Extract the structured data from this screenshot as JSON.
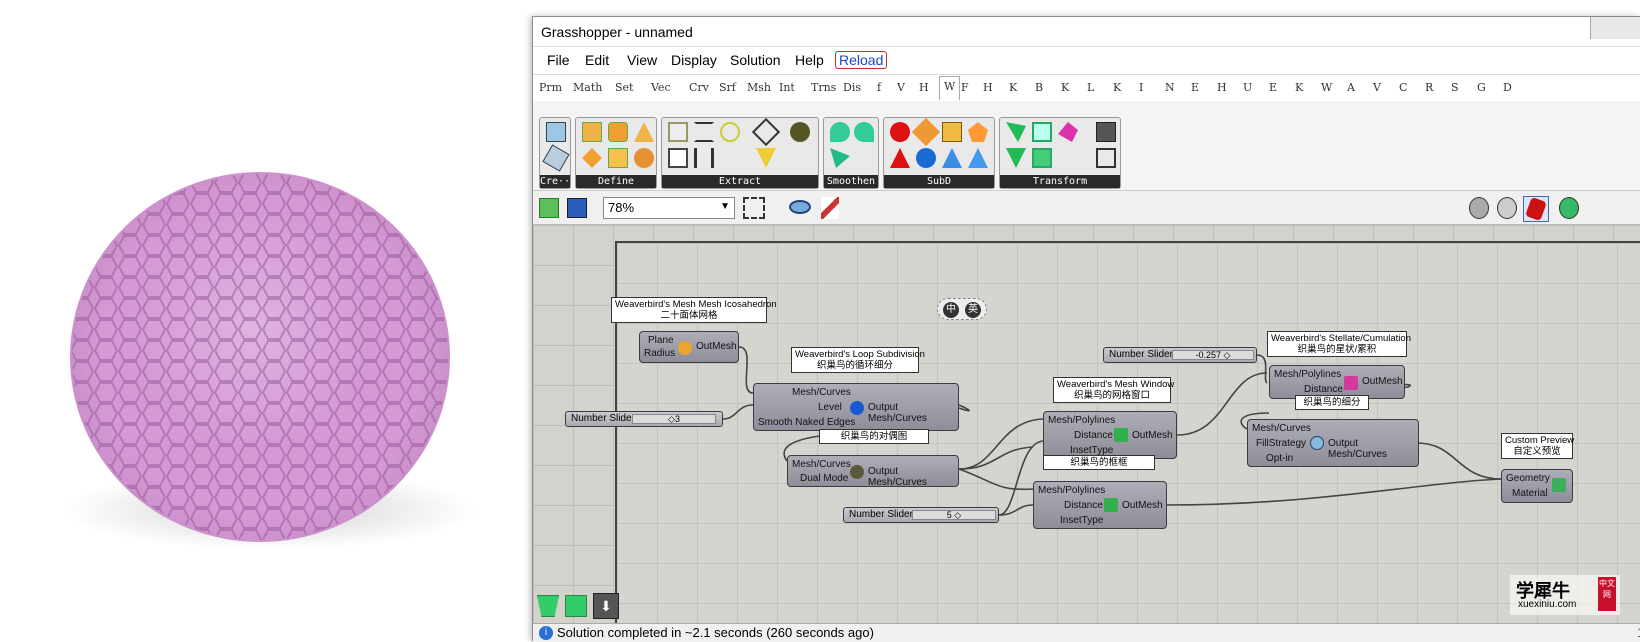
{
  "window": {
    "title": "Grasshopper - unnamed"
  },
  "menu": {
    "items": [
      "File",
      "Edit",
      "View",
      "Display",
      "Solution",
      "Help"
    ],
    "reload": "Reload"
  },
  "tabs": [
    "Prm",
    "Math",
    "Set",
    "Vec",
    "Crv",
    "Srf",
    "Msh",
    "Int",
    "Trns",
    "Dis",
    "f",
    "V",
    "H",
    "W",
    "F",
    "H",
    "K",
    "B",
    "K",
    "L",
    "K",
    "I",
    "N",
    "E",
    "H",
    "U",
    "E",
    "K",
    "W",
    "A",
    "V",
    "C",
    "R",
    "S",
    "G",
    "D"
  ],
  "active_tab": "W",
  "ribbon": {
    "panels": [
      "Cre···",
      "Define",
      "Extract",
      "Smoothen",
      "SubD",
      "Transform"
    ]
  },
  "toolbar": {
    "zoom": "78%"
  },
  "canvas": {
    "lang_toggle": [
      "中",
      "英"
    ],
    "comp_icosa": {
      "title_en": "Weaverbird's Mesh Mesh Icosahedron",
      "title_cn": "二十面体网格",
      "inputs": [
        "Plane",
        "Radius"
      ],
      "output": "OutMesh"
    },
    "comp_loop": {
      "title_en": "Weaverbird's Loop Subdivision",
      "title_cn": "织巢鸟的循环细分",
      "inputs": [
        "Mesh/Curves",
        "Level",
        "Smooth Naked Edges"
      ],
      "output": "Output Mesh/Curves"
    },
    "comp_dual": {
      "title_cn": "织巢鸟的对偶图",
      "inputs": [
        "Mesh/Curves",
        "Dual Mode"
      ],
      "output": "Output Mesh/Curves"
    },
    "comp_window": {
      "title_en": "Weaverbird's Mesh Window",
      "title_cn": "织巢鸟的网格窗口",
      "inputs": [
        "Mesh/Polylines",
        "Distance",
        "InsetType"
      ],
      "output": "OutMesh"
    },
    "comp_frame": {
      "title_cn": "织巢鸟的框框",
      "inputs": [
        "Mesh/Polylines",
        "Distance",
        "InsetType"
      ],
      "output": "OutMesh"
    },
    "comp_stellate": {
      "title_en": "Weaverbird's Stellate/Cumulation",
      "title_cn": "织巢鸟的星状/累积",
      "inputs": [
        "Mesh/Polylines",
        "Distance"
      ],
      "output": "OutMesh"
    },
    "comp_split": {
      "title_cn": "织巢鸟的细分",
      "inputs": [
        "Mesh/Curves",
        "FillStrategy",
        "Opt-in"
      ],
      "output": "Output Mesh/Curves"
    },
    "comp_preview": {
      "title_en": "Custom Preview",
      "title_cn": "自定义预览",
      "inputs": [
        "Geometry",
        "Material"
      ]
    },
    "slider_level": {
      "label": "Number Slider",
      "value": "◇3"
    },
    "slider_distance": {
      "label": "Number Slider",
      "value": "5 ◇"
    },
    "slider_stellate": {
      "label": "Number Slider",
      "value": "-0.257 ◇"
    }
  },
  "watermark": {
    "cn": "学犀牛",
    "en": "xuexiniu.com",
    "badge": "中文网"
  },
  "status": {
    "text": "Solution completed in ~2.1 seconds (260 seconds ago)",
    "right": "1."
  }
}
